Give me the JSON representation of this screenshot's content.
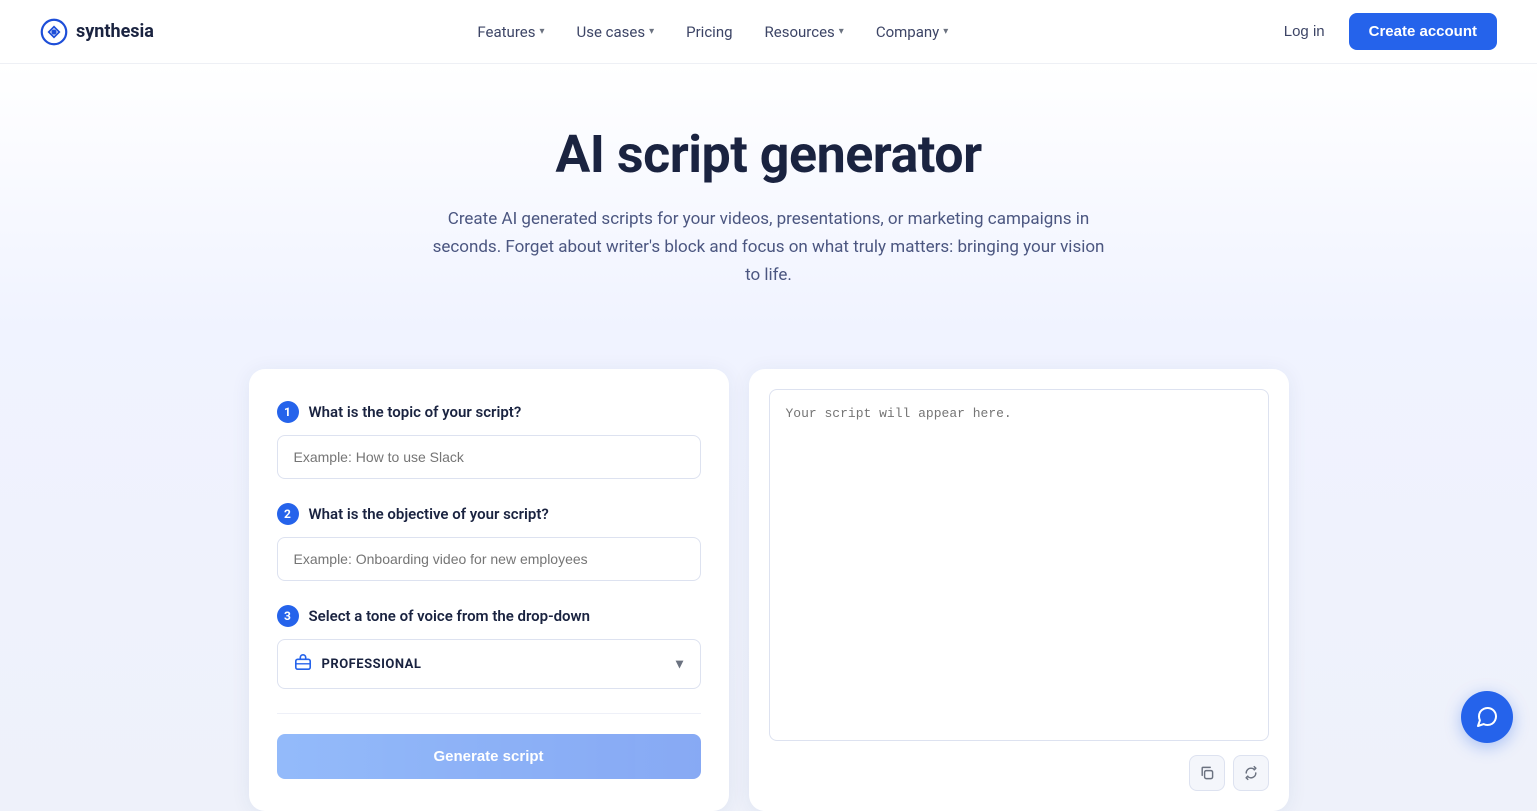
{
  "brand": {
    "name": "synthesia",
    "logo_alt": "Synthesia logo"
  },
  "nav": {
    "links": [
      {
        "label": "Features",
        "has_dropdown": true
      },
      {
        "label": "Use cases",
        "has_dropdown": true
      },
      {
        "label": "Pricing",
        "has_dropdown": false
      },
      {
        "label": "Resources",
        "has_dropdown": true
      },
      {
        "label": "Company",
        "has_dropdown": true
      }
    ],
    "login_label": "Log in",
    "create_label": "Create account"
  },
  "hero": {
    "title": "AI script generator",
    "description": "Create AI generated scripts for your videos, presentations, or marketing campaigns in seconds. Forget about writer's block and focus on what truly matters: bringing your vision to life."
  },
  "form": {
    "step1": {
      "number": "1",
      "title": "What is the topic of your script?",
      "placeholder": "Example: How to use Slack"
    },
    "step2": {
      "number": "2",
      "title": "What is the objective of your script?",
      "placeholder": "Example: Onboarding video for new employees"
    },
    "step3": {
      "number": "3",
      "title": "Select a tone of voice from the drop-down",
      "dropdown_value": "PROFESSIONAL"
    },
    "generate_label": "Generate script"
  },
  "output": {
    "placeholder": "Your script will appear here."
  },
  "chat": {
    "icon": "💬"
  },
  "icons": {
    "chevron_down": "▾",
    "clipboard_icon": "📋",
    "refresh_icon": "↺",
    "suitcase_icon": "💼",
    "copy_icon": "⧉",
    "regenerate_icon": "↻"
  }
}
